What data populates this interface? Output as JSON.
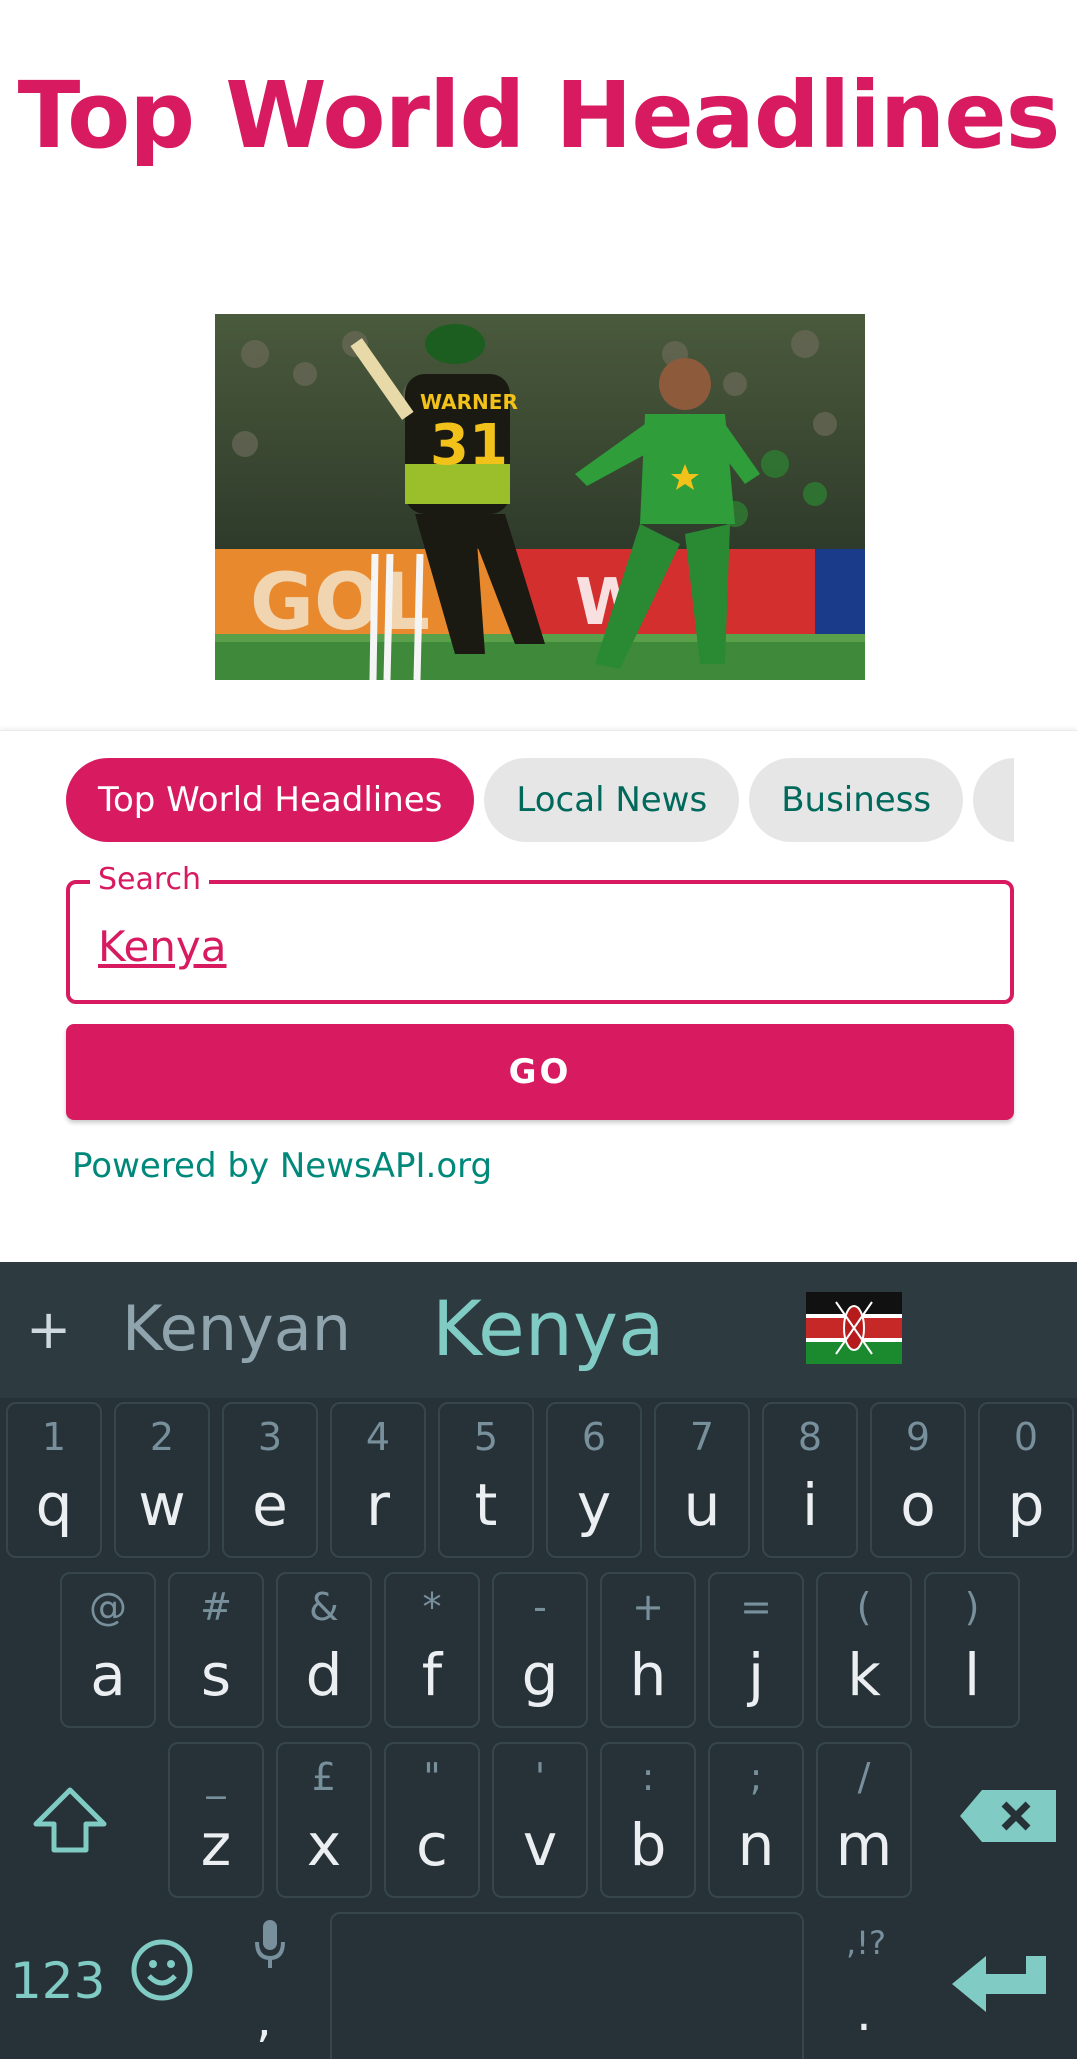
{
  "header": {
    "title": "Top World Headlines"
  },
  "chips": [
    {
      "label": "Top World Headlines",
      "active": true
    },
    {
      "label": "Local News",
      "active": false
    },
    {
      "label": "Business",
      "active": false
    }
  ],
  "search": {
    "label": "Search",
    "value": "Kenya"
  },
  "go_label": "GO",
  "powered_by": "Powered by NewsAPI.org",
  "hero_image": {
    "jersey_name": "WARNER",
    "jersey_number": "31",
    "board_text_left": "GOL",
    "board_text_right": "W"
  },
  "keyboard": {
    "suggestions": [
      "Kenyan",
      "Kenya"
    ],
    "emoji_suggestion": "kenya-flag-emoji",
    "row1": [
      {
        "hint": "1",
        "key": "q"
      },
      {
        "hint": "2",
        "key": "w"
      },
      {
        "hint": "3",
        "key": "e"
      },
      {
        "hint": "4",
        "key": "r"
      },
      {
        "hint": "5",
        "key": "t"
      },
      {
        "hint": "6",
        "key": "y"
      },
      {
        "hint": "7",
        "key": "u"
      },
      {
        "hint": "8",
        "key": "i"
      },
      {
        "hint": "9",
        "key": "o"
      },
      {
        "hint": "0",
        "key": "p"
      }
    ],
    "row2": [
      {
        "hint": "@",
        "key": "a"
      },
      {
        "hint": "#",
        "key": "s"
      },
      {
        "hint": "&",
        "key": "d"
      },
      {
        "hint": "*",
        "key": "f"
      },
      {
        "hint": "-",
        "key": "g"
      },
      {
        "hint": "+",
        "key": "h"
      },
      {
        "hint": "=",
        "key": "j"
      },
      {
        "hint": "(",
        "key": "k"
      },
      {
        "hint": ")",
        "key": "l"
      }
    ],
    "row3": [
      {
        "hint": "_",
        "key": "z"
      },
      {
        "hint": "£",
        "key": "x"
      },
      {
        "hint": "\"",
        "key": "c"
      },
      {
        "hint": "'",
        "key": "v"
      },
      {
        "hint": ":",
        "key": "b"
      },
      {
        "hint": ";",
        "key": "n"
      },
      {
        "hint": "/",
        "key": "m"
      }
    ],
    "num_label": "123",
    "comma": ",",
    "punct_hint": ",!?",
    "period": ".",
    "accent_color": "#80cbc4"
  },
  "colors": {
    "primary": "#d81b60",
    "link": "#00897b",
    "keyboard_bg": "#263238"
  }
}
